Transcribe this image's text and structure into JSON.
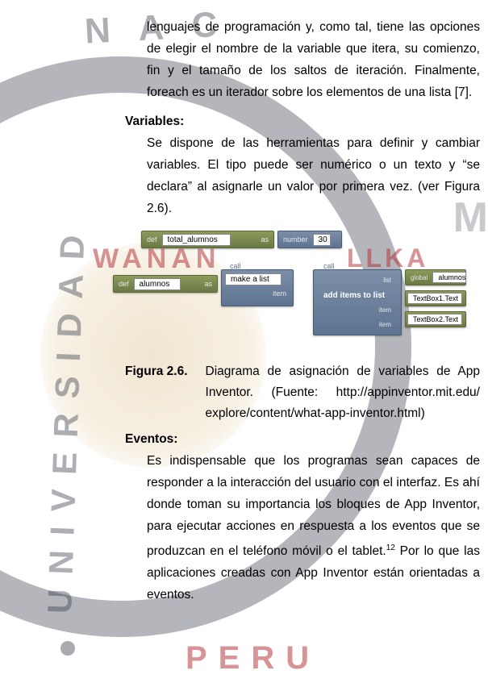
{
  "paragraphs": {
    "intro_cont": "lenguajes de programación y, como tal, tiene las opciones de elegir el nombre de la variable que itera, su comienzo, fin y el tamaño de los saltos de iteración. Finalmente, foreach es un iterador sobre los elementos de una lista [7].",
    "variables_body": "Se dispone de las herramientas para definir y cambiar variables. El tipo puede ser numérico o un texto y “se declara” al asignarle un valor por primera vez. (ver Figura 2.6).",
    "eventos_body": "Es indispensable que los programas sean capaces de responder a la interacción del usuario con el interfaz. Es ahí donde toman su importancia los bloques de App Inventor, para ejecutar acciones en respuesta a los eventos que se produzcan en el teléfono móvil o el tablet.",
    "eventos_body2": " Por lo que las aplicaciones creadas con App Inventor están orientadas a eventos."
  },
  "headings": {
    "variables": "Variables:",
    "eventos": "Eventos:"
  },
  "figure": {
    "label": "Figura 2.6",
    "caption_text": "Diagrama de asignación de variables de App Inventor. (Fuente: http://appinventor.mit.edu/ explore/content/what-app-inventor.html)"
  },
  "blocks": {
    "def": "def",
    "as": "as",
    "total_alumnos": "total_alumnos",
    "number": "number",
    "thirty": "30",
    "alumnos": "alumnos",
    "call": "call",
    "make_a_list": "make a list",
    "item": "item",
    "add_items": "add items to list",
    "list": "list",
    "global": "global",
    "global_alumnos": "alumnos",
    "textbox1": "TextBox1.Text",
    "textbox2": "TextBox2.Text"
  },
  "footnote_ref": "12",
  "watermark": {
    "nac": "N A C",
    "univ": "UNIVERSIDAD",
    "wanan": "WANAN",
    "llka": "LLKA",
    "m": "M",
    "peru": "PERU"
  }
}
